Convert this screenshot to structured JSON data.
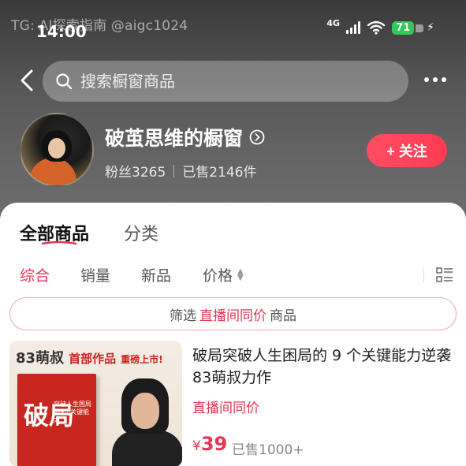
{
  "status_bar": {
    "time": "14:00",
    "network": "4G",
    "battery": "71",
    "watermark": "TG: AI探索指南 @aigc1024"
  },
  "top_bar": {
    "search_placeholder": "搜索橱窗商品"
  },
  "shop": {
    "name": "破茧思维的橱窗",
    "fans": "粉丝3265",
    "sold": "已售2146件",
    "follow_label": "+ 关注"
  },
  "tabs": {
    "all": "全部商品",
    "category": "分类"
  },
  "sort": {
    "comprehensive": "综合",
    "sales": "销量",
    "new": "新品",
    "price": "价格"
  },
  "filter": {
    "prefix": "筛选",
    "highlight": "直播间同价",
    "suffix": "商品"
  },
  "product": {
    "banner_name": "83萌叔",
    "banner_works": "首部作品",
    "banner_launch": "重磅上市!",
    "book_title": "破局",
    "book_subtitle": "突破人生困局的9个关键能力",
    "title": "破局突破人生困局的 9 个关键能力逆袭83萌叔力作",
    "tag": "直播间同价",
    "currency": "¥",
    "price": "39",
    "sold": "已售1000+"
  },
  "colors": {
    "accent": "#e83553",
    "follow_button": "#ff4d62",
    "battery": "#34c759"
  }
}
